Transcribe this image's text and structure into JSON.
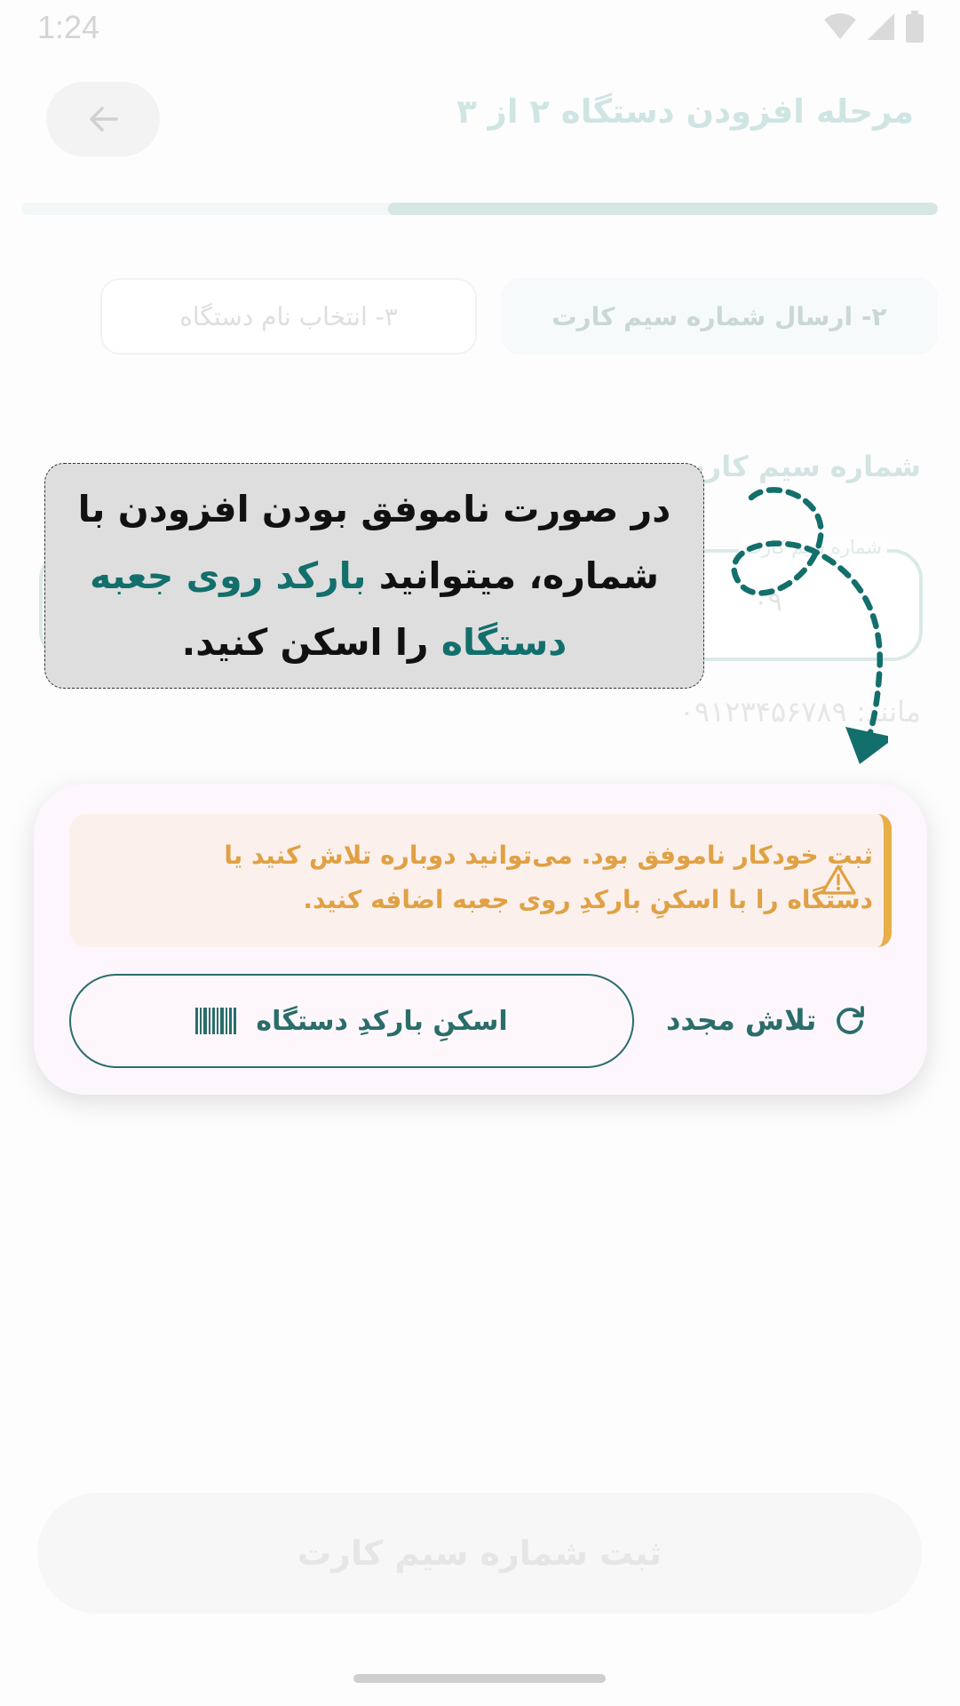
{
  "status_bar": {
    "time": "1:24"
  },
  "header": {
    "title": "مرحله افزودن دستگاه ۲ از ۳"
  },
  "progress": {
    "value": 0.6
  },
  "steps": {
    "active_label": "۲- ارسال شماره سیم کارت",
    "inactive_label": "۳- انتخاب نام دستگاه"
  },
  "field": {
    "label": "شماره سیم کارت",
    "floating_label": "شماره سیم کارت",
    "value": "۰۹",
    "hint": "مانند: ۰۹۱۲۳۴۵۶۷۸۹"
  },
  "tooltip": {
    "part1": "در صورت ناموفق بودن افزودن با شماره، میتوانید ",
    "highlight": "بارکد روی جعبه دستگاه",
    "part2": " را اسکن کنید."
  },
  "alert": {
    "message": "ثبتِ خودکار ناموفق بود. می‌توانید دوباره تلاش کنید یا دستگاه را با اسکنِ بارکدِ روی جعبه اضافه کنید."
  },
  "actions": {
    "scan_label": "اسکنِ بارکدِ دستگاه",
    "retry_label": "تلاش مجدد"
  },
  "submit": {
    "label": "ثبت شماره سیم کارت"
  },
  "colors": {
    "brand": "#136f6c",
    "warning": "#e8ae47"
  }
}
